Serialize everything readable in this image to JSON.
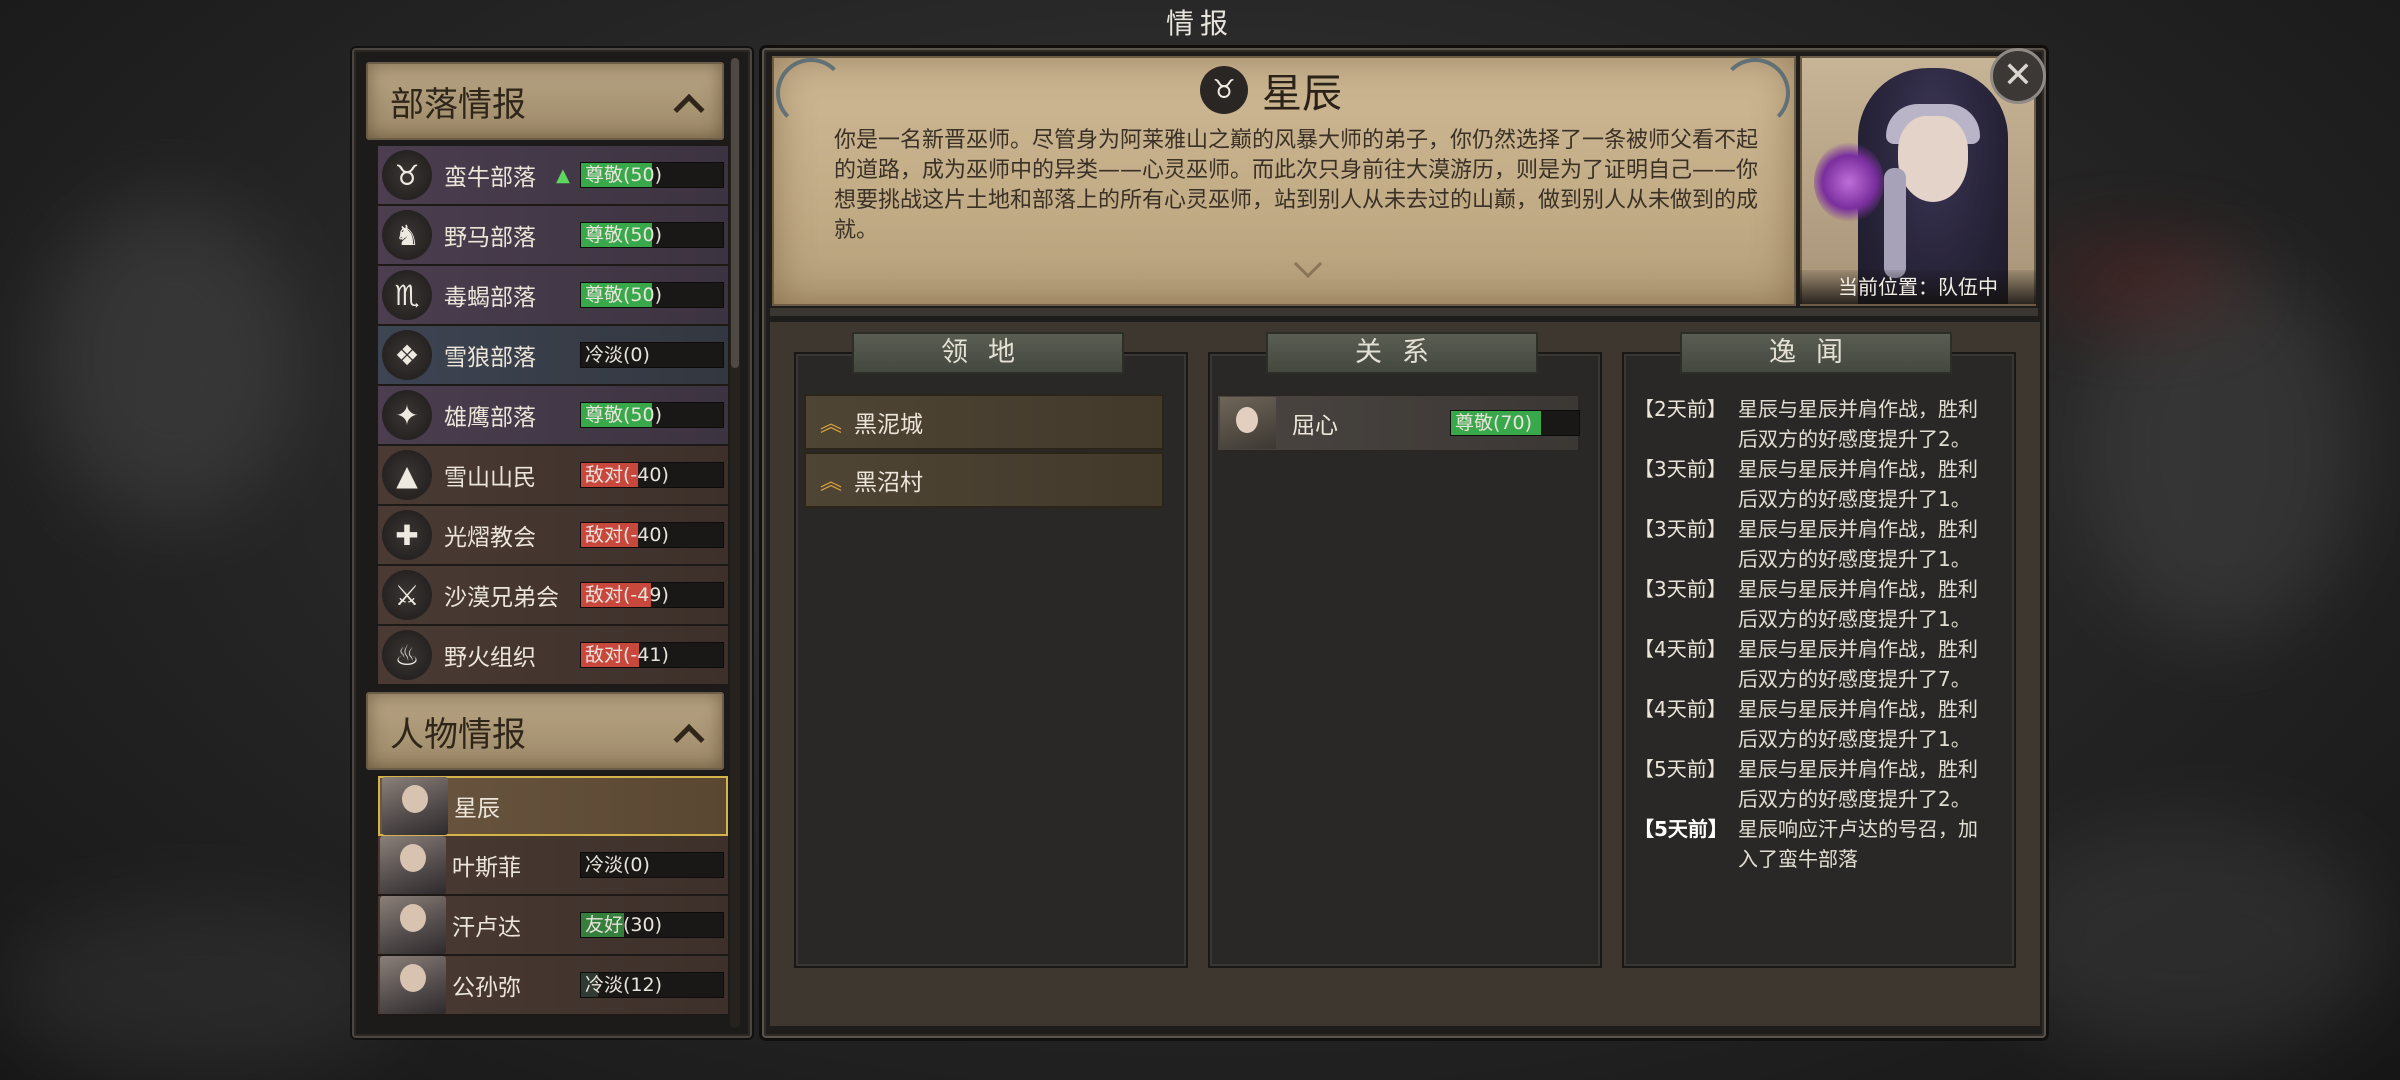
{
  "window_title": "情报",
  "tribes_section": {
    "title": "部落情报"
  },
  "tribes": [
    {
      "name": "蛮牛部落",
      "status": "尊敬(50)",
      "level": 50,
      "kind": "respect",
      "icon": "bull-icon",
      "trend": "▲"
    },
    {
      "name": "野马部落",
      "status": "尊敬(50)",
      "level": 50,
      "kind": "respect",
      "icon": "horse-icon"
    },
    {
      "name": "毒蝎部落",
      "status": "尊敬(50)",
      "level": 50,
      "kind": "respect",
      "icon": "scorpion-icon"
    },
    {
      "name": "雪狼部落",
      "status": "冷淡(0)",
      "level": 0,
      "kind": "cold",
      "icon": "wolf-icon"
    },
    {
      "name": "雄鹰部落",
      "status": "尊敬(50)",
      "level": 50,
      "kind": "respect",
      "icon": "eagle-icon"
    },
    {
      "name": "雪山山民",
      "status": "敌对(-40)",
      "level": -40,
      "kind": "hostile",
      "icon": "mountain-icon"
    },
    {
      "name": "光熠教会",
      "status": "敌对(-40)",
      "level": -40,
      "kind": "hostile",
      "icon": "church-icon"
    },
    {
      "name": "沙漠兄弟会",
      "status": "敌对(-49)",
      "level": -49,
      "kind": "hostile",
      "icon": "crossed-swords-icon"
    },
    {
      "name": "野火组织",
      "status": "敌对(-41)",
      "level": -41,
      "kind": "hostile",
      "icon": "flame-icon"
    }
  ],
  "people_section": {
    "title": "人物情报"
  },
  "people": [
    {
      "name": "星辰",
      "status": "",
      "selected": true
    },
    {
      "name": "叶斯菲",
      "status": "冷淡(0)",
      "level": 0,
      "kind": "cold"
    },
    {
      "name": "汗卢达",
      "status": "友好(30)",
      "level": 30,
      "kind": "friendly"
    },
    {
      "name": "公孙弥",
      "status": "冷淡(12)",
      "level": 12,
      "kind": "cold"
    }
  ],
  "character": {
    "name": "星辰",
    "bio": "你是一名新晋巫师。尽管身为阿莱雅山之巅的风暴大师的弟子，你仍然选择了一条被师父看不起的道路，成为巫师中的异类——心灵巫师。而此次只身前往大漠游历，则是为了证明自己——你想要挑战这片土地和部落上的所有心灵巫师，站到别人从未去过的山巅，做到别人从未做到的成就。",
    "location": "当前位置：队伍中"
  },
  "columns": {
    "territory": {
      "title": "领地",
      "items": [
        "黑泥城",
        "黑沼村"
      ]
    },
    "relations": {
      "title": "关系",
      "items": [
        {
          "name": "屈心",
          "status": "尊敬(70)",
          "level": 70
        }
      ]
    },
    "gossip": {
      "title": "逸闻",
      "entries": [
        {
          "time": "【2天前】",
          "text": "星辰与星辰并肩作战，胜利后双方的好感度提升了2。"
        },
        {
          "time": "【3天前】",
          "text": "星辰与星辰并肩作战，胜利后双方的好感度提升了1。"
        },
        {
          "time": "【3天前】",
          "text": "星辰与星辰并肩作战，胜利后双方的好感度提升了1。"
        },
        {
          "time": "【3天前】",
          "text": "星辰与星辰并肩作战，胜利后双方的好感度提升了1。"
        },
        {
          "time": "【4天前】",
          "text": "星辰与星辰并肩作战，胜利后双方的好感度提升了7。"
        },
        {
          "time": "【4天前】",
          "text": "星辰与星辰并肩作战，胜利后双方的好感度提升了1。"
        },
        {
          "time": "【5天前】",
          "text": "星辰与星辰并肩作战，胜利后双方的好感度提升了2。"
        },
        {
          "time": "【5天前】",
          "text": "星辰响应汗卢达的号召，加入了蛮牛部落",
          "bold": true
        }
      ]
    }
  },
  "colors": {
    "respect": "#39a84a",
    "hostile": "#c9483e",
    "cold": "#2f3a33",
    "friendly": "#367e3c",
    "accent": "#d6b24a"
  }
}
